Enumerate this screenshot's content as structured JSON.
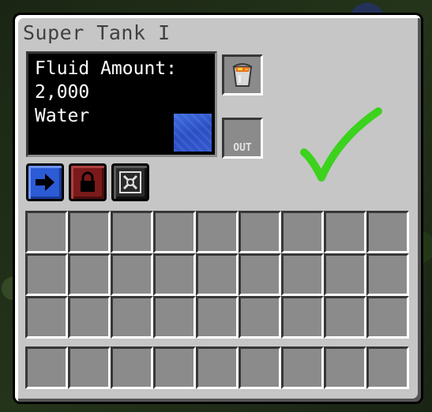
{
  "window": {
    "title": "Super Tank I"
  },
  "fluid_display": {
    "heading": "Fluid Amount:",
    "amount": "2,000",
    "fluid_name": "Water",
    "fluid_color": "#3258d0"
  },
  "slots": {
    "input_icon": "lava-bucket-icon",
    "output_label": "OUT"
  },
  "config_buttons": [
    {
      "icon": "arrow-right-icon",
      "color": "#2c5bd6"
    },
    {
      "icon": "lock-icon",
      "color": "#7a1a1a"
    },
    {
      "icon": "redstone-x-icon",
      "color": "#2a2a2a"
    }
  ],
  "inventory": {
    "rows": 3,
    "columns": 9
  },
  "hotbar": {
    "columns": 9
  },
  "overlay": {
    "checkmark_color": "#3cd21e"
  }
}
